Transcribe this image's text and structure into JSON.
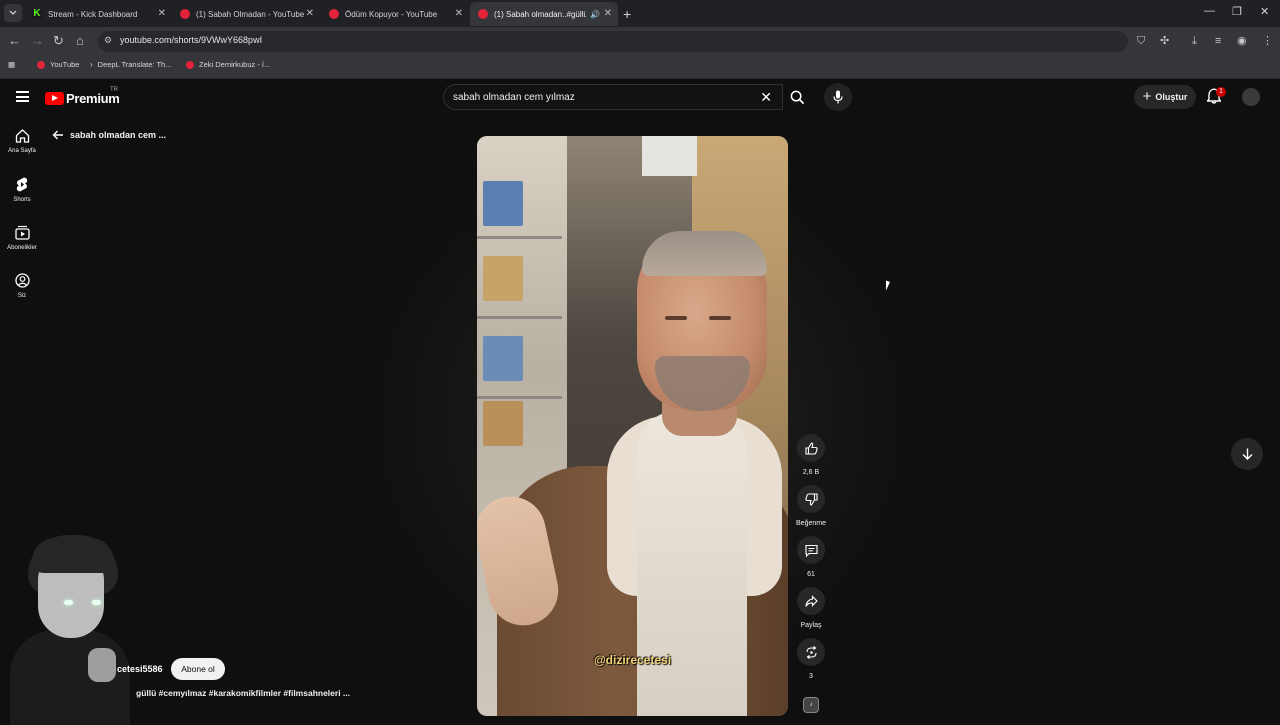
{
  "browser": {
    "tabs": [
      {
        "title": "Stream - Kick Dashboard",
        "favicon": "kick-icon"
      },
      {
        "title": "(1) Sabah Olmadan - YouTube",
        "favicon": "youtube-icon"
      },
      {
        "title": "Ödüm Kopuyor - YouTube",
        "favicon": "youtube-icon"
      },
      {
        "title": "(1) Sabah olmadan..#güllü",
        "favicon": "youtube-icon",
        "active": true
      }
    ],
    "url": "youtube.com/shorts/9VWwY668pwI",
    "bookmarks": [
      {
        "label": "YouTube",
        "favicon": "youtube-icon"
      },
      {
        "label": "DeepL Translate: Th...",
        "favicon": "deepl-icon"
      },
      {
        "label": "Zeki Demirkubuz - İ...",
        "favicon": "youtube-icon"
      }
    ]
  },
  "yt": {
    "logo_text": "Premium",
    "logo_region": "TR",
    "search_query": "sabah olmadan cem yılmaz",
    "create_label": "Oluştur",
    "notification_count": "1",
    "sidebar": [
      {
        "label": "Ana Sayfa",
        "icon": "home-icon"
      },
      {
        "label": "Shorts",
        "icon": "shorts-icon"
      },
      {
        "label": "Abonelikler",
        "icon": "subscriptions-icon"
      },
      {
        "label": "Siz",
        "icon": "account-icon"
      }
    ],
    "back_label": "sabah olmadan cem ...",
    "short": {
      "watermark": "@dizirecetesi",
      "channel": "cetesi5586",
      "subscribe_label": "Abone ol",
      "description": "güllü #cemyılmaz #karakomikfilmler #filmsahneleri ..."
    },
    "actions": {
      "like_count": "2,6 B",
      "dislike_label": "Beğenme",
      "comment_count": "61",
      "share_label": "Paylaş",
      "remix_count": "3"
    }
  },
  "colors": {
    "brand_red": "#ff0000",
    "background": "#0f0f0f",
    "kick_green": "#53fc18"
  }
}
